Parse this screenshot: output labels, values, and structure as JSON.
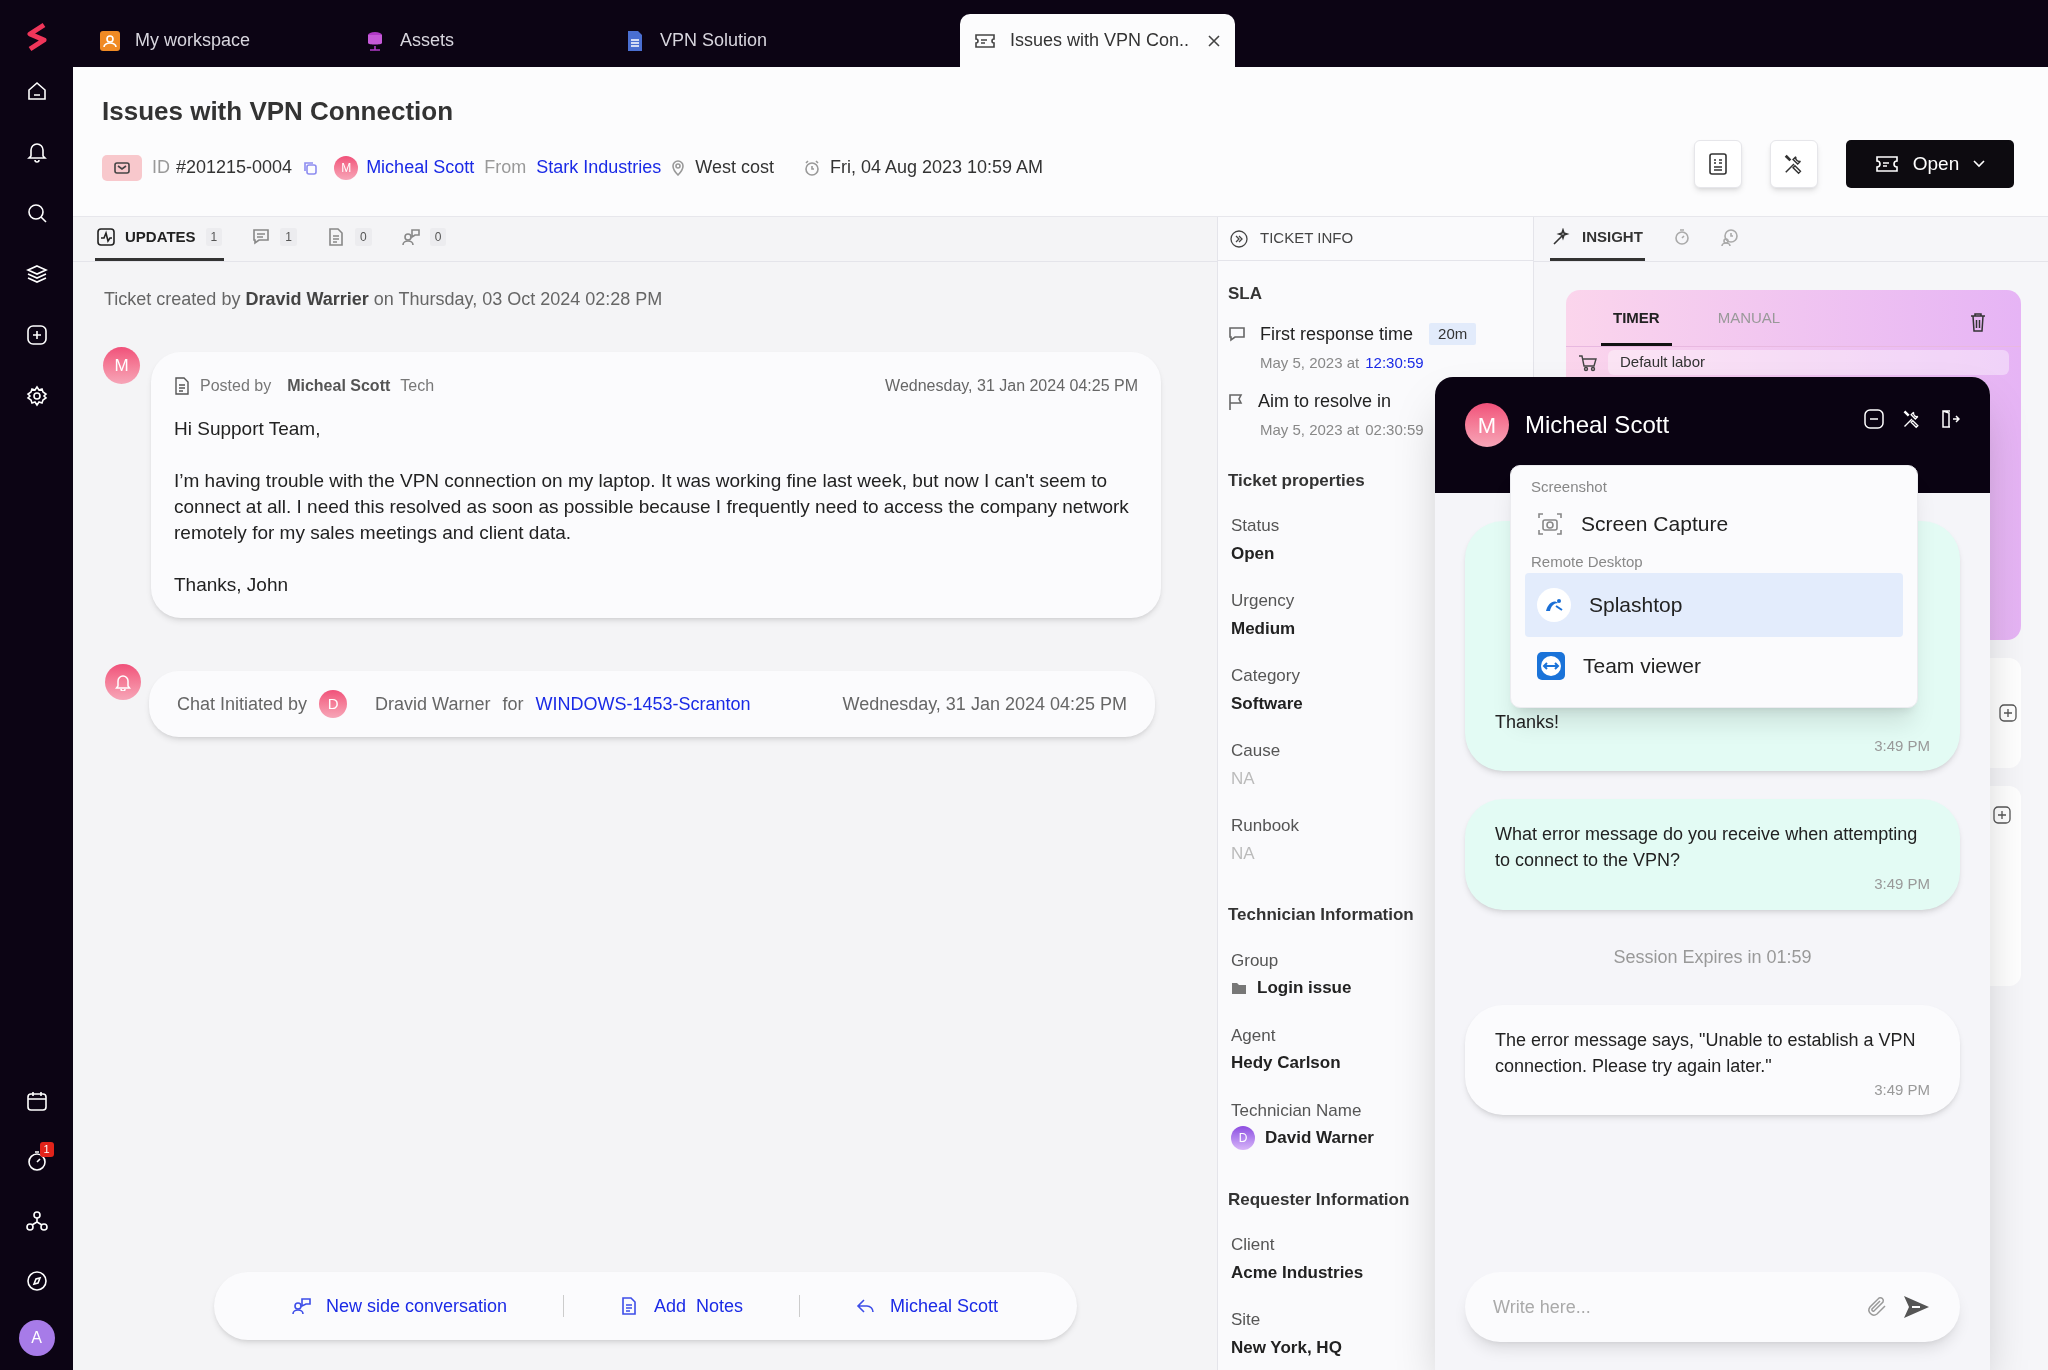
{
  "sidebar": {
    "timer_badge": "1",
    "avatar": "A"
  },
  "tabs": [
    {
      "label": "My workspace",
      "selected": false
    },
    {
      "label": "Assets",
      "selected": false
    },
    {
      "label": "VPN Solution",
      "selected": false
    },
    {
      "label": "Issues with VPN Con..",
      "selected": true
    }
  ],
  "ticket": {
    "title": "Issues with VPN Connection",
    "id_label": "ID",
    "id": "#201215-0004",
    "requester_initial": "M",
    "requester": "Micheal Scott",
    "from_label": "From",
    "company": "Stark Industries",
    "location": "West cost",
    "date": "Fri, 04 Aug 2023 10:59 AM",
    "status_button": "Open"
  },
  "update_tabs": [
    {
      "label": "UPDATES",
      "count": "1",
      "selected": true
    },
    {
      "count": "1",
      "selected": false
    },
    {
      "count": "0",
      "selected": false
    },
    {
      "count": "0",
      "selected": false
    }
  ],
  "created_line": "Ticket created by **Dravid Warrier** on Thursday, 03 Oct 2024 02:28 PM",
  "post": {
    "avatar": "M",
    "posted_by": "Posted by",
    "author": "Micheal Scott",
    "role": "Tech",
    "time": "Wednesday, 31 Jan 2024 04:25 PM",
    "paragraphs": [
      "Hi Support Team,",
      "I’m having trouble with the VPN connection on my laptop. It was working fine last week, but now I can't seem to connect at all. I need this resolved as soon as possible because I frequently need to access the company network remotely for my sales meetings and client data.",
      "Thanks, John"
    ]
  },
  "chat_event": {
    "label": "Chat Initiated by",
    "avatar": "D",
    "person": "Dravid Warner",
    "for_label": "for",
    "asset": "WINDOWS-1453-Scranton",
    "time": "Wednesday, 31 Jan 2024 04:25 PM"
  },
  "bottom_actions": [
    {
      "label": "New side conversation"
    },
    {
      "label": "Add  Notes"
    },
    {
      "label": "Micheal Scott"
    }
  ],
  "ticket_info": {
    "heading": "TICKET INFO",
    "sla_heading": "SLA",
    "sla": [
      {
        "label": "First response time",
        "badge": "20m",
        "date": "May 5, 2023 at",
        "time": "12:30:59",
        "highlight": true
      },
      {
        "label": "Aim to resolve in",
        "date": "May 5, 2023 at",
        "time": "02:30:59",
        "highlight": false
      }
    ],
    "sections": [
      {
        "title": "Ticket properties",
        "fields": [
          {
            "label": "Status",
            "value": "Open",
            "kind": "text"
          },
          {
            "label": "Urgency",
            "value": "Medium",
            "kind": "text"
          },
          {
            "label": "Category",
            "value": "Software",
            "kind": "text"
          },
          {
            "label": "Cause",
            "value": "NA",
            "kind": "empty"
          },
          {
            "label": "Runbook",
            "value": "NA",
            "kind": "empty"
          }
        ]
      },
      {
        "title": "Technician Information",
        "fields": [
          {
            "label": "Group",
            "value": "Login issue",
            "kind": "folder"
          },
          {
            "label": "Agent",
            "value": "Hedy Carlson",
            "kind": "text"
          },
          {
            "label": "Technician Name",
            "value": "David Warner",
            "initial": "D",
            "kind": "person"
          }
        ]
      },
      {
        "title": "Requester Information",
        "fields": [
          {
            "label": "Client",
            "value": "Acme Industries",
            "kind": "text"
          },
          {
            "label": "Site",
            "value": "New York, HQ",
            "kind": "text"
          }
        ]
      }
    ]
  },
  "insight": {
    "tabs": [
      {
        "label": "INSIGHT",
        "selected": true
      },
      {
        "selected": false
      },
      {
        "selected": false
      }
    ],
    "timer_tabs": [
      {
        "label": "TIMER",
        "selected": true
      },
      {
        "label": "MANUAL",
        "selected": false
      }
    ],
    "labor_select": "Default labor"
  },
  "chat": {
    "initial": "M",
    "name": "Micheal Scott",
    "messages": [
      {
        "kind": "incoming",
        "text": "Thanks!",
        "time": "3:49 PM"
      },
      {
        "kind": "incoming",
        "text": "What error message do you receive when attempting to connect to the VPN?",
        "time": "3:49 PM"
      },
      {
        "kind": "notice",
        "text": "Session Expires in 01:59"
      },
      {
        "kind": "outgoing",
        "text": "The error message says, \"Unable to establish a VPN connection. Please try again later.\"",
        "time": "3:49 PM"
      }
    ],
    "input": {
      "placeholder": "Write here..."
    }
  },
  "menu": {
    "groups": [
      {
        "title": "Screenshot",
        "items": [
          {
            "label": "Screen Capture",
            "selected": false
          }
        ]
      },
      {
        "title": "Remote Desktop",
        "items": [
          {
            "label": "Splashtop",
            "selected": true
          },
          {
            "label": "Team viewer",
            "selected": false
          }
        ]
      }
    ]
  }
}
